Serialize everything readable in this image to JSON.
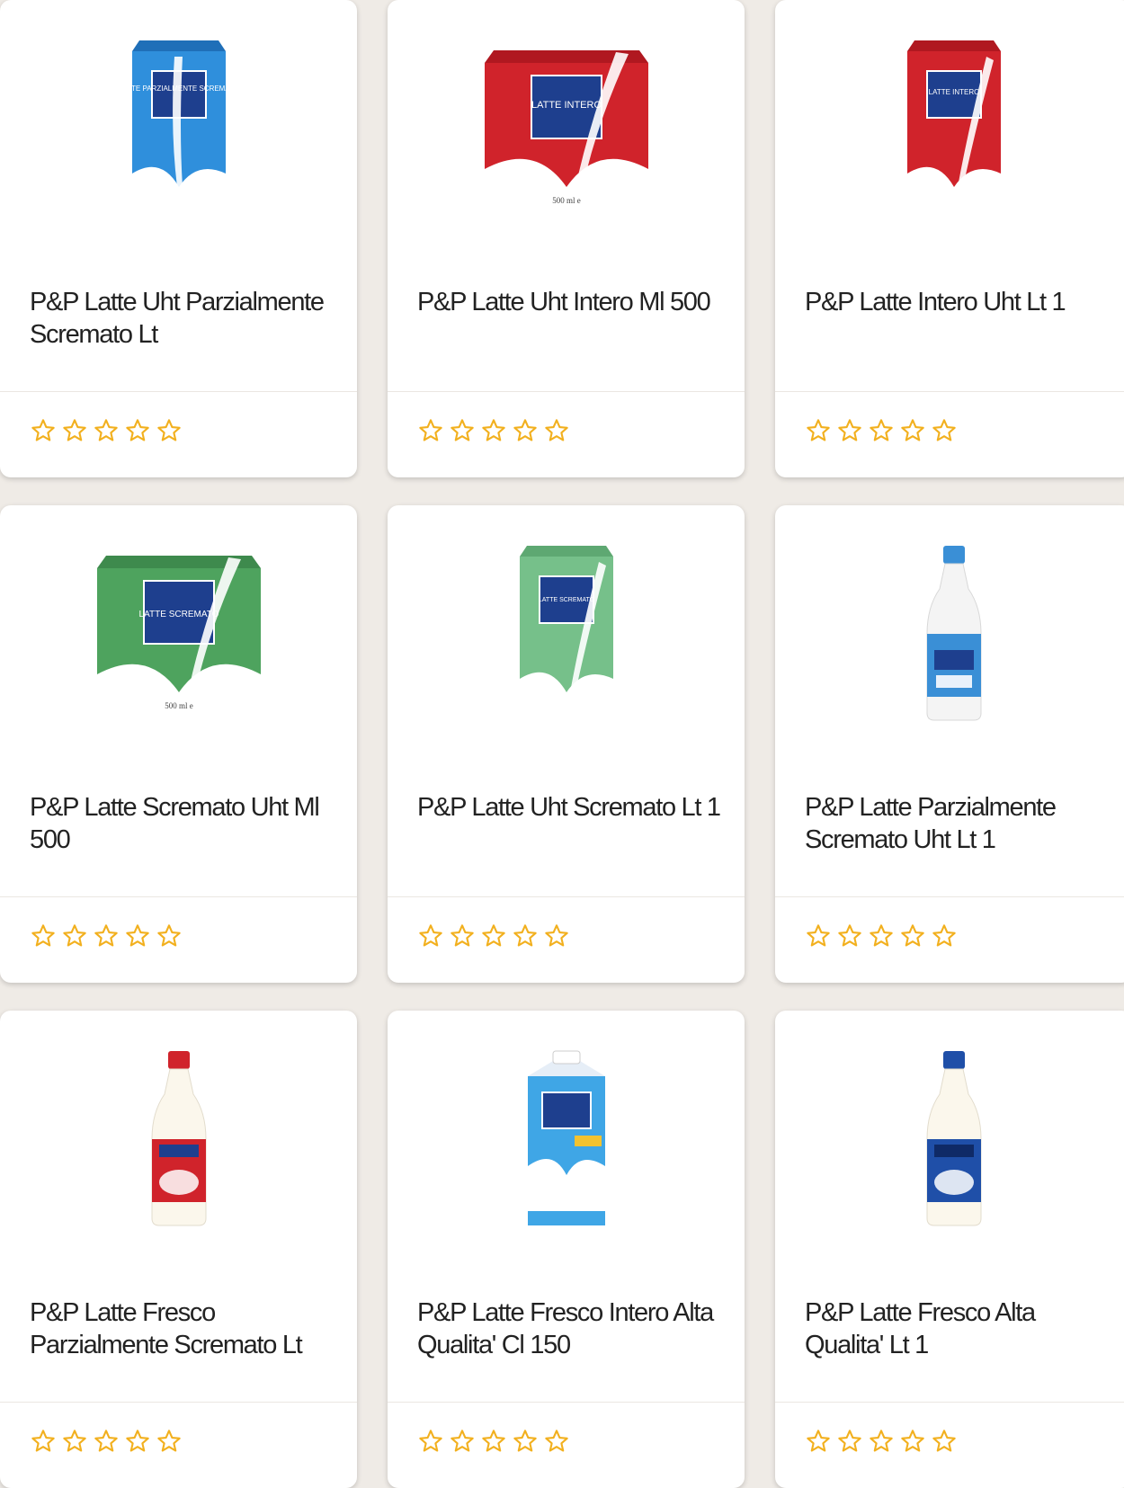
{
  "star_color": "#f2b01e",
  "products": [
    {
      "title": "P&P Latte Uht Parzialmente Scremato Lt",
      "rating": 0,
      "image": {
        "kind": "carton",
        "color": "#2f8fdc",
        "label": "LATTE PARZIALMENTE SCREMATO"
      }
    },
    {
      "title": "P&P Latte Uht Intero Ml 500",
      "rating": 0,
      "image": {
        "kind": "carton-wide",
        "color": "#d0232b",
        "label": "LATTE INTERO",
        "size": "500 ml e"
      }
    },
    {
      "title": "P&P Latte Intero Uht Lt 1",
      "rating": 0,
      "image": {
        "kind": "carton",
        "color": "#d0232b",
        "label": "LATTE INTERO"
      }
    },
    {
      "title": "P&P Latte Scremato Uht Ml 500",
      "rating": 0,
      "image": {
        "kind": "carton-wide",
        "color": "#4ea35e",
        "label": "LATTE SCREMATO",
        "size": "500 ml e"
      }
    },
    {
      "title": "P&P Latte Uht Scremato Lt 1",
      "rating": 0,
      "image": {
        "kind": "carton",
        "color": "#76c08a",
        "label": "LATTE SCREMATO"
      }
    },
    {
      "title": "P&P Latte Parzialmente Scremato Uht Lt 1",
      "rating": 0,
      "image": {
        "kind": "bottle",
        "color": "#3a8fd6",
        "label": ""
      }
    },
    {
      "title": "P&P Latte Fresco Parzialmente Scremato Lt",
      "rating": 0,
      "image": {
        "kind": "bottle",
        "color": "#d0232b",
        "label": ""
      }
    },
    {
      "title": "P&P Latte Fresco Intero Alta Qualita' Cl 150",
      "rating": 0,
      "image": {
        "kind": "gable",
        "color": "#3fa6e6",
        "label": ""
      }
    },
    {
      "title": "P&P Latte Fresco Alta Qualita' Lt 1",
      "rating": 0,
      "image": {
        "kind": "bottle",
        "color": "#1f4fa8",
        "label": ""
      }
    }
  ]
}
